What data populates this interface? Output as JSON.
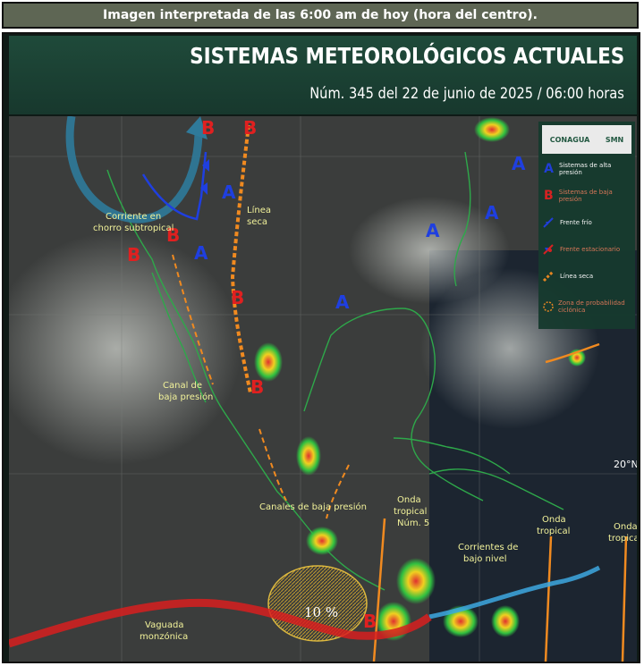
{
  "caption": "Imagen interpretada de las 6:00 am de hoy (hora del centro).",
  "header": {
    "title": "SISTEMAS METEOROLÓGICOS ACTUALES",
    "subtitle": "Núm. 345 del 22 de junio de 2025 / 06:00 horas"
  },
  "logos": {
    "conagua": "CONAGUA",
    "smn": "SMN"
  },
  "legend": [
    {
      "symbol": "A",
      "label": "Sistemas de alta presión",
      "color": "#1f3fe0"
    },
    {
      "symbol": "B",
      "label": "Sistemas de baja presión",
      "color": "#e02020"
    },
    {
      "symbol": "frente-frio-icon",
      "label": "Frente frío",
      "color": "#1f3fe0"
    },
    {
      "symbol": "frente-estacionario-icon",
      "label": "Frente estacionario",
      "color": "#e02020"
    },
    {
      "symbol": "linea-seca-icon",
      "label": "Línea seca",
      "color": "#f08a20"
    },
    {
      "symbol": "zona-probabilidad-icon",
      "label": "Zona de probabilidad ciclónica",
      "color": "#f08a20"
    }
  ],
  "map_labels": {
    "corriente_chorro": [
      "Corriente en",
      "chorro subtropical"
    ],
    "linea_seca": [
      "Línea",
      "seca"
    ],
    "canal_baja": [
      "Canal de",
      "baja presión"
    ],
    "canales_baja": "Canales de baja presión",
    "onda_5": [
      "Onda",
      "tropical",
      "Núm. 5"
    ],
    "corrientes_bajo": [
      "Corrientes de",
      "bajo nivel"
    ],
    "onda_centro": [
      "Onda",
      "tropical"
    ],
    "onda_este": [
      "Onda",
      "tropical"
    ],
    "vaguada": [
      "Vaguada",
      "monzónica"
    ],
    "probabilidad": "10 %",
    "lat": "20°N"
  },
  "pressure_systems": {
    "high": "A",
    "low": "B"
  },
  "colors": {
    "high": "#1f3fe0",
    "low": "#e02020",
    "dryline": "#f08a20",
    "jet": "#2f7a9a",
    "trough": "#d81e1e",
    "land": "#3a3f3b"
  }
}
